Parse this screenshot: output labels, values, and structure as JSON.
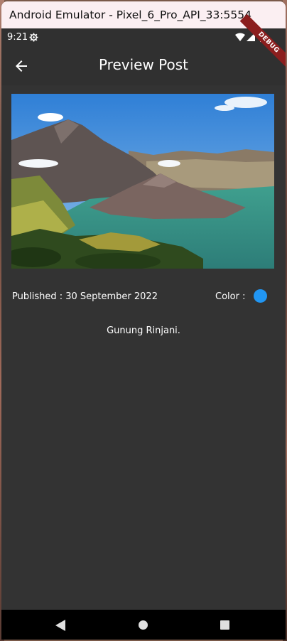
{
  "window": {
    "title": "Android Emulator - Pixel_6_Pro_API_33:5554"
  },
  "status_bar": {
    "time": "9:21",
    "icons": [
      "gear-icon",
      "wifi-icon",
      "signal-icon",
      "battery-icon"
    ]
  },
  "debug_banner": "DEBUG",
  "app_bar": {
    "title": "Preview Post",
    "back_icon": "arrow-back-icon"
  },
  "post": {
    "image_subject": "mountain crater lake landscape",
    "published": "Published : 30 September 2022",
    "color_label": "Color :",
    "color_value": "#2196f3",
    "caption": "Gunung Rinjani."
  },
  "nav_bar": {
    "icons": [
      "back-triangle-icon",
      "home-circle-icon",
      "recents-square-icon"
    ]
  }
}
